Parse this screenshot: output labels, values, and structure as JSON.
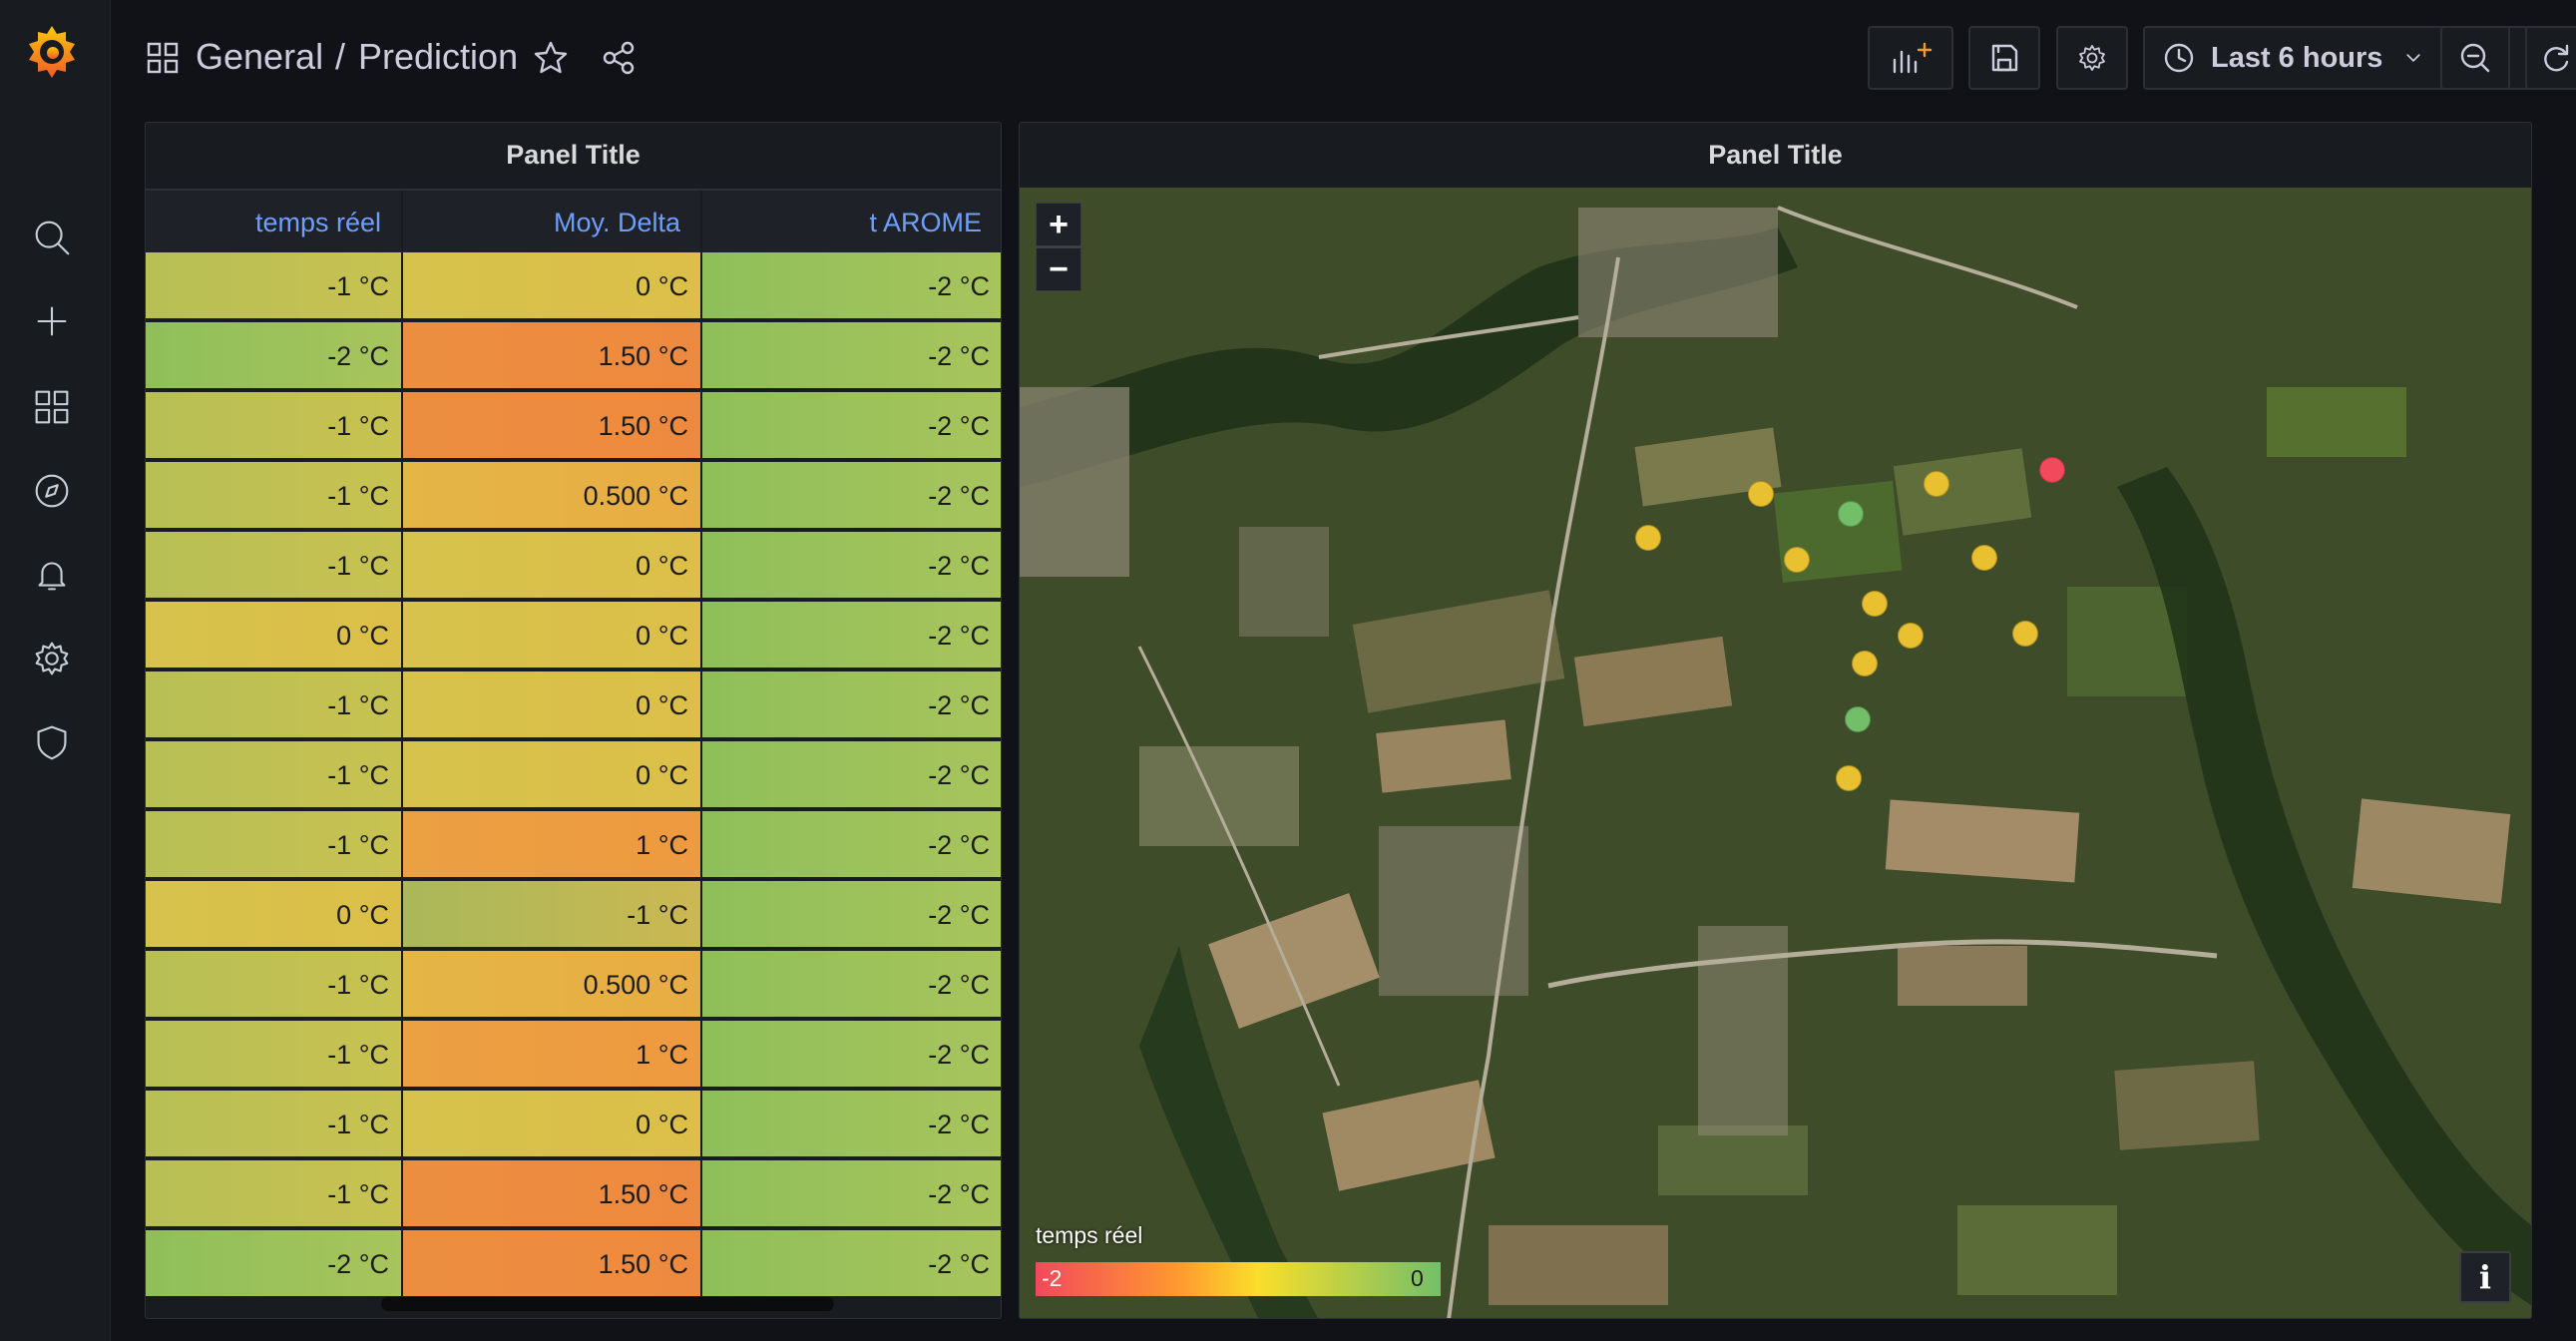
{
  "breadcrumb": {
    "folder": "General",
    "separator": "/",
    "dashboard": "Prediction"
  },
  "toolbar": {
    "time_range": "Last 6 hours"
  },
  "table_panel": {
    "title": "Panel Title",
    "columns": [
      "temps réel",
      "Moy. Delta",
      "t AROME"
    ],
    "rows": [
      [
        "-1 °C",
        "0 °C",
        "-2 °C"
      ],
      [
        "-2 °C",
        "1.50 °C",
        "-2 °C"
      ],
      [
        "-1 °C",
        "1.50 °C",
        "-2 °C"
      ],
      [
        "-1 °C",
        "0.500 °C",
        "-2 °C"
      ],
      [
        "-1 °C",
        "0 °C",
        "-2 °C"
      ],
      [
        "0 °C",
        "0 °C",
        "-2 °C"
      ],
      [
        "-1 °C",
        "0 °C",
        "-2 °C"
      ],
      [
        "-1 °C",
        "0 °C",
        "-2 °C"
      ],
      [
        "-1 °C",
        "1 °C",
        "-2 °C"
      ],
      [
        "0 °C",
        "-1 °C",
        "-2 °C"
      ],
      [
        "-1 °C",
        "0.500 °C",
        "-2 °C"
      ],
      [
        "-1 °C",
        "1 °C",
        "-2 °C"
      ],
      [
        "-1 °C",
        "0 °C",
        "-2 °C"
      ],
      [
        "-1 °C",
        "1.50 °C",
        "-2 °C"
      ],
      [
        "-2 °C",
        "1.50 °C",
        "-2 °C"
      ]
    ]
  },
  "map_panel": {
    "title": "Panel Title",
    "zoom_in": "+",
    "zoom_out": "−",
    "legend": {
      "field": "temps réel",
      "min": "-2",
      "max": "0"
    },
    "info_label": "i",
    "marker_colors": {
      "red": "#f2495c",
      "yellow": "#e8c030",
      "green": "#73bf69"
    }
  },
  "colors": {
    "background": "#111217",
    "panel": "#181b1f",
    "accent_link": "#6e9fff"
  },
  "icons": [
    "grafana-logo-icon",
    "search-icon",
    "plus-icon",
    "dashboards-icon",
    "explore-icon",
    "alert-bell-icon",
    "gear-icon",
    "shield-icon",
    "apps-icon",
    "star-icon",
    "share-icon",
    "add-panel-icon",
    "save-icon",
    "clock-icon",
    "chevron-down-icon",
    "zoom-out-icon",
    "refresh-icon",
    "info-icon"
  ]
}
